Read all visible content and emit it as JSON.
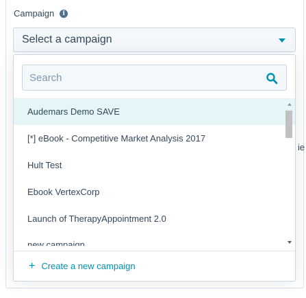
{
  "field": {
    "label": "Campaign",
    "info_icon": "info-icon"
  },
  "select": {
    "placeholder": "Select a campaign",
    "icon": "caret-down-icon"
  },
  "dropdown": {
    "search": {
      "placeholder": "Search",
      "value": "",
      "icon": "search-icon"
    },
    "items": [
      {
        "label": "Audemars Demo SAVE"
      },
      {
        "label": "[*] eBook - Competitive Market Analysis 2017"
      },
      {
        "label": "Hult Test"
      },
      {
        "label": "Ebook VertexCorp"
      },
      {
        "label": "Launch of TherapyAppointment 2.0"
      },
      {
        "label": "new campaign"
      }
    ],
    "create_label": "Create a new campaign",
    "create_icon": "plus-icon"
  },
  "background_fragment": "ie",
  "colors": {
    "accent": "#0091ae",
    "text": "#33475b",
    "active_row": "#e5f5f8",
    "border": "#cbd6e2"
  }
}
